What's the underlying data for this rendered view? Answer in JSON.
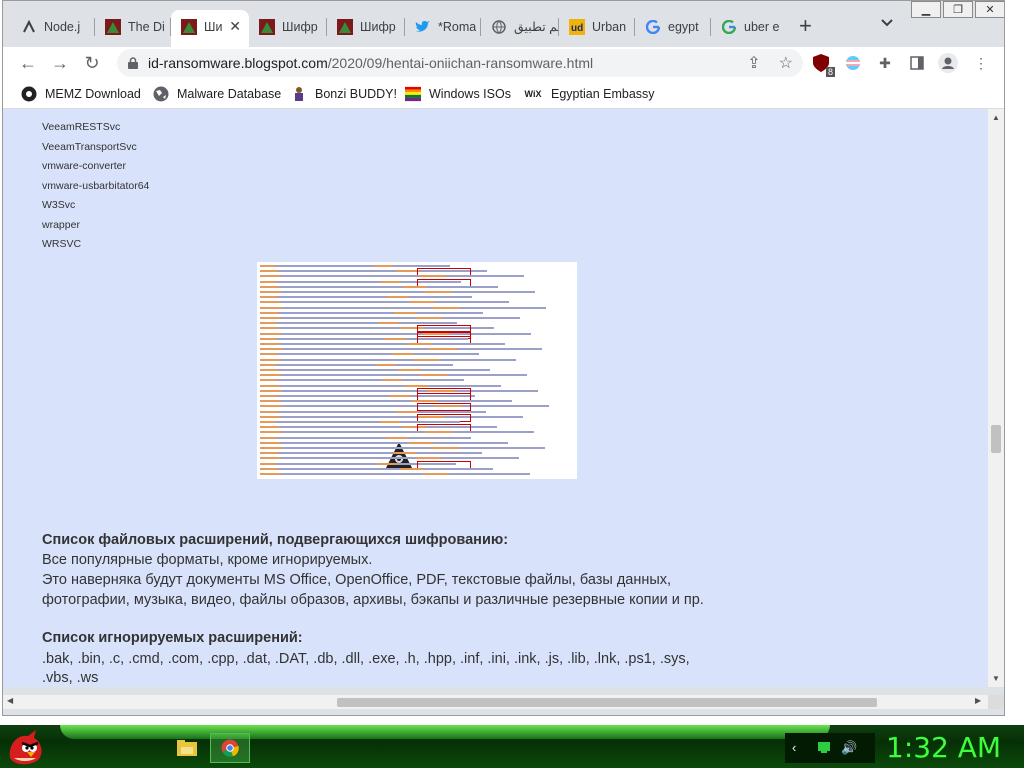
{
  "browser": {
    "tabs": [
      {
        "title": "Node.j",
        "icon": "node-icon",
        "active": false
      },
      {
        "title": "The Di",
        "icon": "blogger-icon",
        "active": false
      },
      {
        "title": "Ши",
        "icon": "blogger-icon",
        "active": true
      },
      {
        "title": "Шифр",
        "icon": "blogger-icon",
        "active": false
      },
      {
        "title": "Шифр",
        "icon": "blogger-icon",
        "active": false
      },
      {
        "title": "*Roma",
        "icon": "twitter-icon",
        "active": false
      },
      {
        "title": "تم تطبيق",
        "icon": "globe-icon",
        "active": false
      },
      {
        "title": "Urban",
        "icon": "urban-icon",
        "active": false
      },
      {
        "title": "egypt",
        "icon": "google-icon",
        "active": false
      },
      {
        "title": "uber e",
        "icon": "google-icon",
        "active": false
      }
    ],
    "new_tab": "+",
    "url_host": "id-ransomware.blogspot.com",
    "url_path": "/2020/09/hentai-oniichan-ransomware.html",
    "extension_badge": "8",
    "bookmarks": [
      {
        "label": "MEMZ Download",
        "icon": "chrome-icon"
      },
      {
        "label": "Malware Database",
        "icon": "globe-icon"
      },
      {
        "label": "Bonzi BUDDY!",
        "icon": "bonzi-icon"
      },
      {
        "label": "Windows ISOs",
        "icon": "rainbow-icon"
      },
      {
        "label": "Egyptian Embassy",
        "icon": "wix-icon"
      }
    ],
    "wix_text": "WiX"
  },
  "page": {
    "services": [
      "VeeamRESTSvc",
      "VeeamTransportSvc",
      "vmware-converter",
      "vmware-usbarbitator64",
      "W3Svc",
      "wrapper",
      "WRSVC"
    ],
    "heading1": "Список файловых расширений, подвергающихся шифрованию:",
    "para1": [
      "Все популярные форматы, кроме игнорируемых.",
      "Это наверняка будут документы MS Office, OpenOffice, PDF, текстовые файлы, базы данных,",
      "фотографии, музыка, видео, файлы образов, архивы, бэкапы и различные резервные копии и пр."
    ],
    "heading2": "Список игнорируемых расширений:",
    "para2": [
      ".bak, .bin, .c, .cmd, .com, .cpp, .dat, .DAT, .db, .dll, .exe, .h, .hpp, .inf, .ini, .ink, .js, .lib, .lnk, .ps1, .sys,",
      ".vbs, .ws"
    ]
  },
  "taskbar": {
    "clock": "1:32 AM"
  },
  "colors": {
    "page_bg": "#d9e2fb",
    "clock": "#3cff3c",
    "highlight_box": "#cc0000"
  }
}
